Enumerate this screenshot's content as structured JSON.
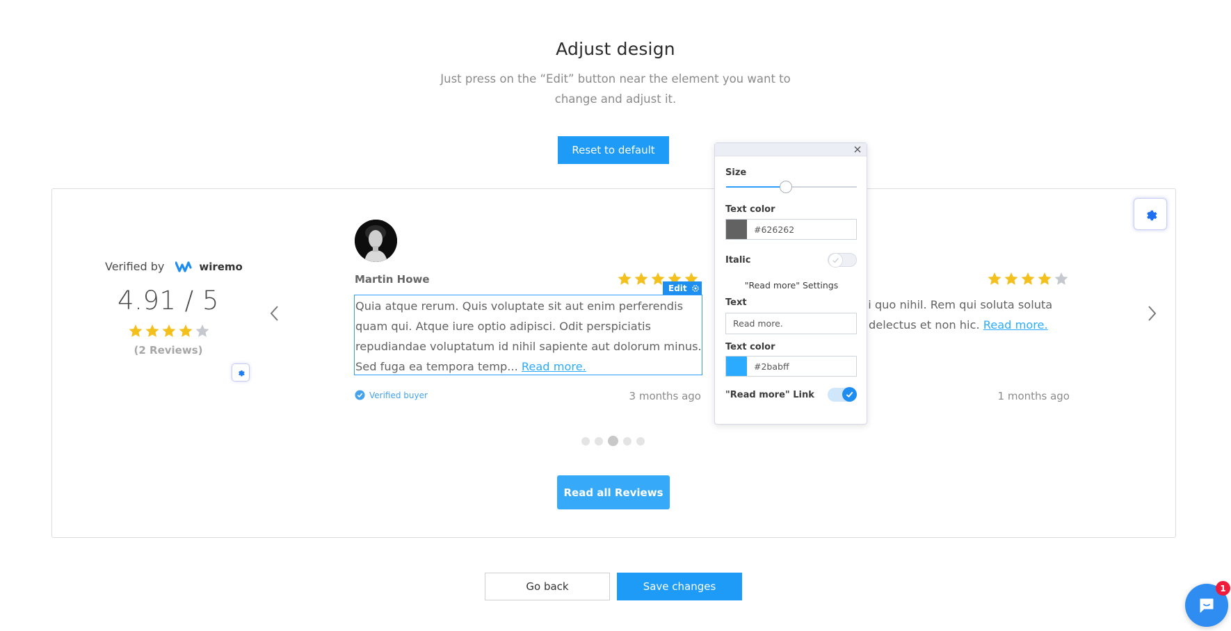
{
  "header": {
    "title": "Adjust design",
    "subtitle": "Just press on the “Edit” button near the element you want to change and adjust it."
  },
  "reset_button": "Reset to default",
  "summary": {
    "verified_by": "Verified by",
    "brand": "wiremo",
    "rating": "4.91 / 5",
    "stars": 4,
    "reviews_count": "(2 Reviews)"
  },
  "review_1": {
    "name": "Martin Howe",
    "stars": 5,
    "text": "Quia atque rerum. Quis voluptate sit aut enim perferendis quam qui. Atque iure optio adipisci. Odit perspiciatis repudiandae voluptatum id nihil sapiente aut dolorum minus. Sed fuga ea tempora temp...",
    "read_more": "Read more.",
    "edit_label": "Edit",
    "verified_buyer": "Verified buyer",
    "date": "3 months ago"
  },
  "review_2": {
    "stars": 4,
    "text_line1": "ui quo nihil. Rem qui soluta soluta",
    "text_line2": "delectus et non hic.",
    "read_more": "Read more.",
    "date": "1 months ago"
  },
  "carousel": {
    "dot_count": 5,
    "active_index": 2
  },
  "read_all_button": "Read all Reviews",
  "popup": {
    "size_label": "Size",
    "size_value": 0.46,
    "text_color_label": "Text color",
    "text_color_value": "#626262",
    "italic_label": "Italic",
    "italic_on": false,
    "section_title": "\"Read more\" Settings",
    "text_label": "Text",
    "text_value": "Read more.",
    "link_color_label": "Text color",
    "link_color_value": "#2babff",
    "link_toggle_label": "\"Read more\" Link",
    "link_toggle_on": true
  },
  "footer": {
    "back_button": "Go back",
    "save_button": "Save changes"
  },
  "chat": {
    "badge_count": "1"
  },
  "colors": {
    "primary": "#1d9bf6",
    "star": "#f4c01e",
    "star_empty": "#c5c8ce",
    "link": "#2babff"
  }
}
